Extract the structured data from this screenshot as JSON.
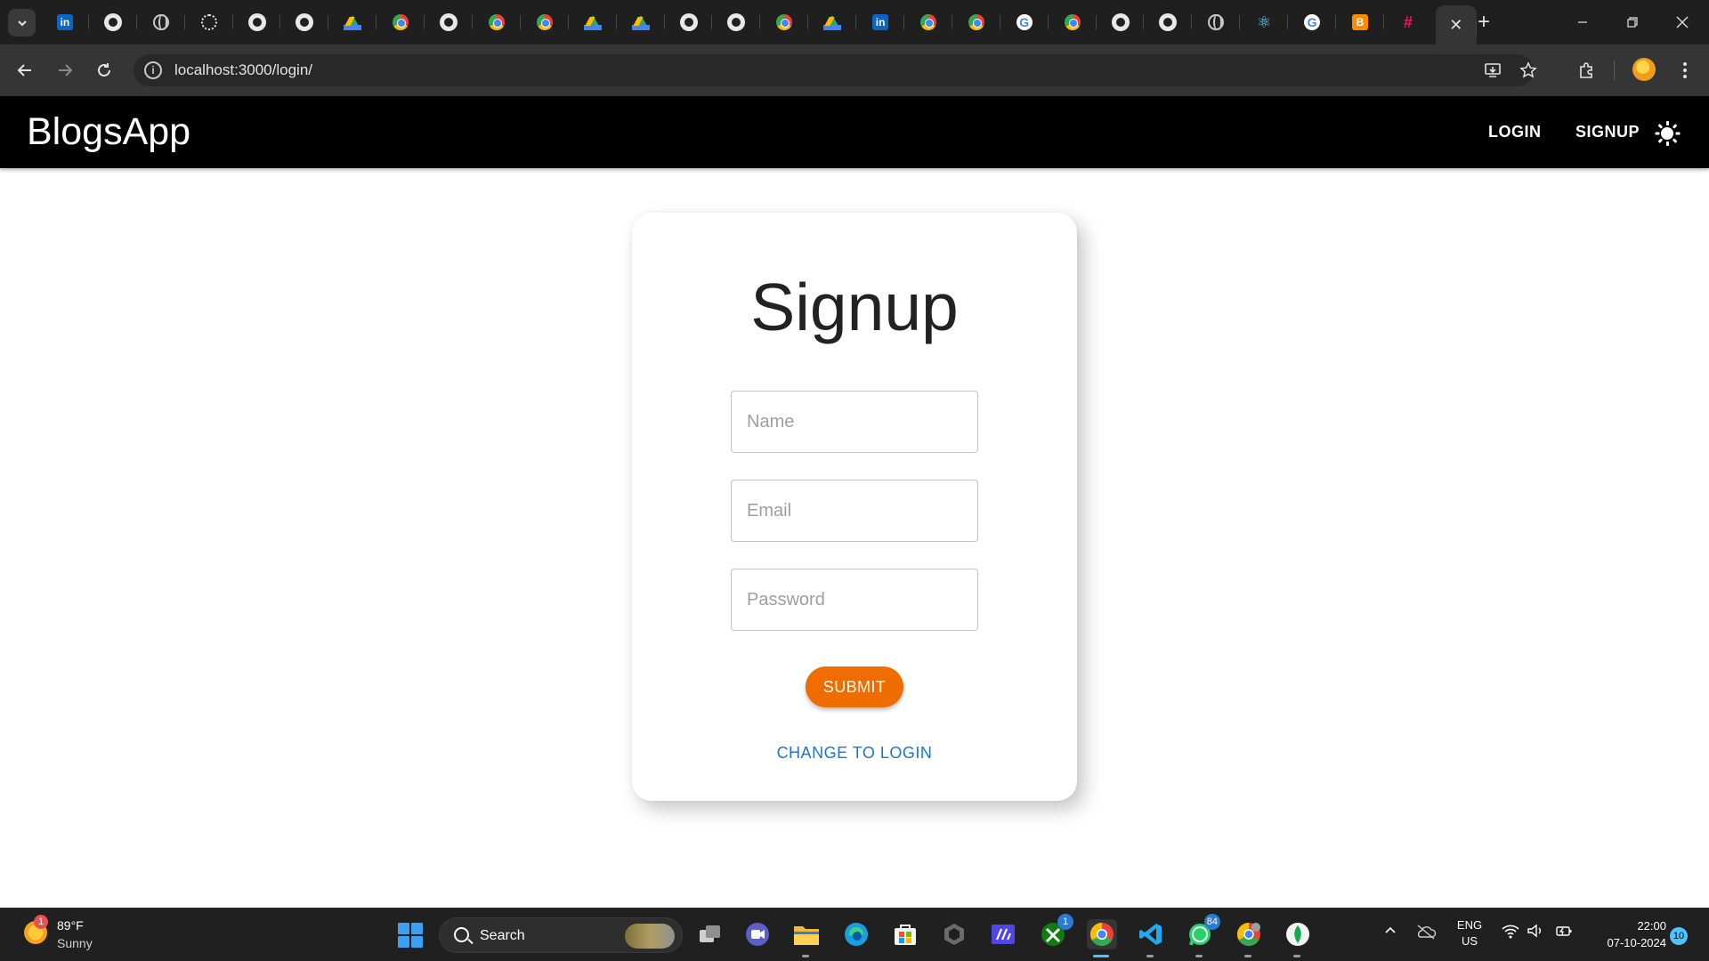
{
  "browser": {
    "tabs": [
      {
        "icon": "linkedin-icon"
      },
      {
        "icon": "github-icon"
      },
      {
        "icon": "globe-icon"
      },
      {
        "icon": "chatgpt-icon"
      },
      {
        "icon": "github-icon"
      },
      {
        "icon": "github-icon"
      },
      {
        "icon": "google-drive-icon"
      },
      {
        "icon": "chrome-icon"
      },
      {
        "icon": "github-icon"
      },
      {
        "icon": "chrome-icon"
      },
      {
        "icon": "chrome-icon"
      },
      {
        "icon": "google-drive-icon"
      },
      {
        "icon": "google-drive-icon"
      },
      {
        "icon": "github-icon"
      },
      {
        "icon": "github-icon"
      },
      {
        "icon": "chrome-icon"
      },
      {
        "icon": "google-drive-icon"
      },
      {
        "icon": "linkedin-icon"
      },
      {
        "icon": "chrome-icon"
      },
      {
        "icon": "chrome-icon"
      },
      {
        "icon": "google-icon"
      },
      {
        "icon": "chrome-icon"
      },
      {
        "icon": "github-icon"
      },
      {
        "icon": "github-icon"
      },
      {
        "icon": "globe-icon"
      },
      {
        "icon": "react-icon"
      },
      {
        "icon": "google-icon"
      },
      {
        "icon": "blogger-icon"
      },
      {
        "icon": "slack-icon"
      }
    ],
    "active_tab_icon": "close-icon",
    "url": "localhost:3000/login/"
  },
  "app": {
    "brand": "BlogsApp",
    "nav": {
      "login_label": "LOGIN",
      "signup_label": "SIGNUP"
    },
    "theme_icon": "sun-icon"
  },
  "form": {
    "title": "Signup",
    "name_placeholder": "Name",
    "email_placeholder": "Email",
    "password_placeholder": "Password",
    "submit_label": "SUBMIT",
    "switch_label": "CHANGE TO LOGIN",
    "accent_color": "#ef6c00",
    "link_color": "#1976d2"
  },
  "taskbar": {
    "weather": {
      "badge": "1",
      "temperature": "89°F",
      "condition": "Sunny"
    },
    "search_label": "Search",
    "badges": {
      "xbox": "1",
      "whatsapp": "84"
    },
    "language": {
      "line1": "ENG",
      "line2": "US"
    },
    "clock": {
      "time": "22:00",
      "date": "07-10-2024"
    },
    "notifications": "10"
  }
}
